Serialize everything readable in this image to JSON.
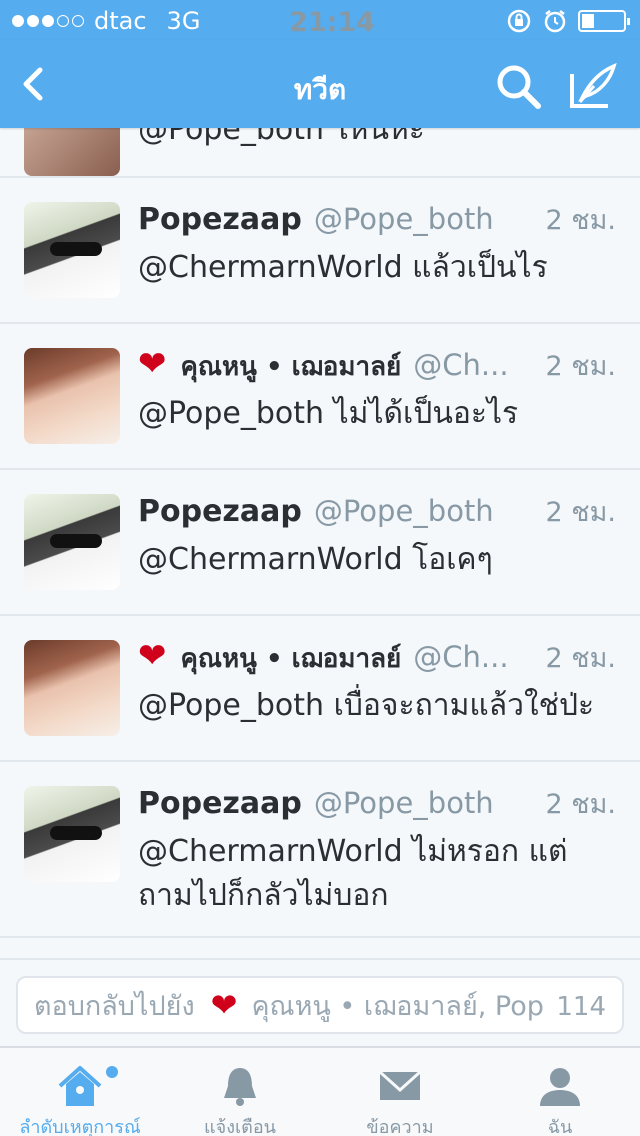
{
  "status_bar": {
    "carrier": "dtac",
    "network": "3G",
    "time": "21:14",
    "signal_dots_filled": 3,
    "signal_dots_total": 5
  },
  "nav": {
    "title": "ทวีต",
    "back_icon": "chevron-left-icon",
    "search_icon": "search-icon",
    "compose_icon": "compose-icon"
  },
  "feed": {
    "cut_tweet_text": "@Pope_both ไหนหะ",
    "tweets": [
      {
        "name": "Popezaap",
        "handle": "@Pope_both",
        "time": "2 ชม.",
        "text": "@ChermarnWorld แล้วเป็นไร",
        "heart": false,
        "avatar": "man"
      },
      {
        "name": "คุณหนู • เฌอมาลย์",
        "handle": "@Ch...",
        "time": "2 ชม.",
        "text": "@Pope_both ไม่ได้เป็นอะไร",
        "heart": true,
        "avatar": "woman"
      },
      {
        "name": "Popezaap",
        "handle": "@Pope_both",
        "time": "2 ชม.",
        "text": "@ChermarnWorld โอเคๆ",
        "heart": false,
        "avatar": "man"
      },
      {
        "name": "คุณหนู • เฌอมาลย์",
        "handle": "@Ch...",
        "time": "2 ชม.",
        "text": "@Pope_both เบื่อจะถามแล้วใช่ป่ะ",
        "heart": true,
        "avatar": "woman"
      },
      {
        "name": "Popezaap",
        "handle": "@Pope_both",
        "time": "2 ชม.",
        "text": "@ChermarnWorld ไม่หรอก แต่ถามไปก็กลัวไม่บอก",
        "heart": false,
        "avatar": "man"
      }
    ]
  },
  "reply": {
    "prefix": "ตอบกลับไปยัง",
    "recipients": "คุณหนู • เฌอมาลย์, Pop",
    "char_count": "114"
  },
  "tabs": [
    {
      "label": "ลำดับเหตุการณ์",
      "icon": "home-icon",
      "active": true
    },
    {
      "label": "แจ้งเตือน",
      "icon": "bell-icon",
      "active": false
    },
    {
      "label": "ข้อความ",
      "icon": "envelope-icon",
      "active": false
    },
    {
      "label": "ฉัน",
      "icon": "person-icon",
      "active": false
    }
  ],
  "colors": {
    "brand": "#55acee",
    "heart": "#d0021b",
    "muted": "#8899a6"
  }
}
